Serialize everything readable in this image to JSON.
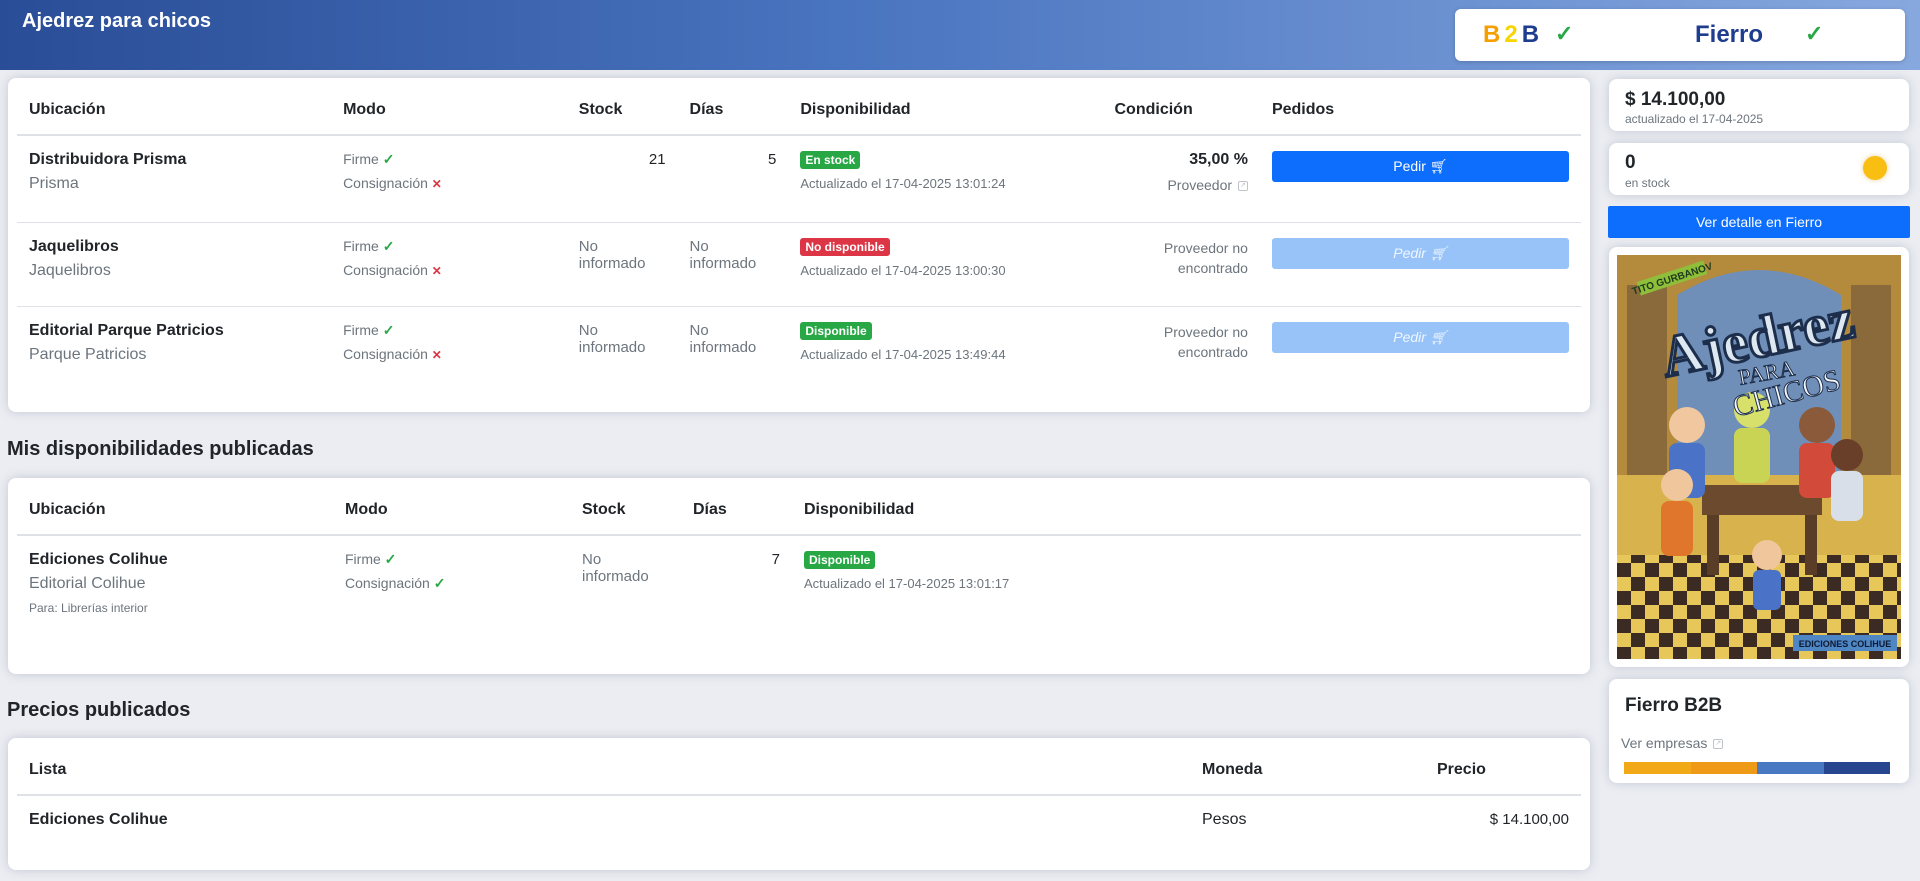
{
  "header": {
    "title": "Ajedrez para chicos"
  },
  "brands": {
    "b2b": [
      "B",
      "2",
      "B"
    ],
    "b2b_check": "✓",
    "fierro": "Fierro",
    "fierro_check": "✓"
  },
  "availability_table": {
    "headers": {
      "ubicacion": "Ubicación",
      "modo": "Modo",
      "stock": "Stock",
      "dias": "Días",
      "disponibilidad": "Disponibilidad",
      "condicion": "Condición",
      "pedidos": "Pedidos"
    },
    "rows": [
      {
        "name": "Distribuidora Prisma",
        "sub": "Prisma",
        "firme": "Firme",
        "consignacion": "Consignación",
        "stock": "21",
        "dias": "5",
        "badge": "En stock",
        "updated": "Actualizado el 17-04-2025 13:01:24",
        "condition": "35,00 %",
        "condition_sub": "Proveedor",
        "pedir": "Pedir"
      },
      {
        "name": "Jaquelibros",
        "sub": "Jaquelibros",
        "firme": "Firme",
        "consignacion": "Consignación",
        "stock": "No informado",
        "dias": "No informado",
        "badge": "No disponible",
        "updated": "Actualizado el 17-04-2025 13:00:30",
        "condition_line1": "Proveedor no",
        "condition_line2": "encontrado",
        "pedir": "Pedir"
      },
      {
        "name": "Editorial Parque Patricios",
        "sub": "Parque Patricios",
        "firme": "Firme",
        "consignacion": "Consignación",
        "stock": "No informado",
        "dias": "No informado",
        "badge": "Disponible",
        "updated": "Actualizado el 17-04-2025 13:49:44",
        "condition_line1": "Proveedor no",
        "condition_line2": "encontrado",
        "pedir": "Pedir"
      }
    ]
  },
  "published_availability": {
    "title": "Mis disponibilidades publicadas",
    "headers": {
      "ubicacion": "Ubicación",
      "modo": "Modo",
      "stock": "Stock",
      "dias": "Días",
      "disponibilidad": "Disponibilidad"
    },
    "rows": [
      {
        "name": "Ediciones Colihue",
        "sub": "Editorial Colihue",
        "note": "Para: Librerías interior",
        "firme": "Firme",
        "consignacion": "Consignación",
        "stock": "No informado",
        "dias": "7",
        "badge": "Disponible",
        "updated": "Actualizado el 17-04-2025 13:01:17"
      }
    ]
  },
  "published_prices": {
    "title": "Precios publicados",
    "headers": {
      "lista": "Lista",
      "moneda": "Moneda",
      "precio": "Precio"
    },
    "rows": [
      {
        "lista": "Ediciones Colihue",
        "moneda": "Pesos",
        "precio": "$ 14.100,00"
      }
    ]
  },
  "sidebar": {
    "price": "$ 14.100,00",
    "price_updated": "actualizado el 17-04-2025",
    "stock": "0",
    "stock_label": "en stock",
    "fierro_button": "Ver detalle en Fierro",
    "cover": {
      "author": "TITO GURBANOV",
      "title_main": "Ajedrez",
      "title_sub1": "PARA",
      "title_sub2": "CHICOS",
      "publisher": "EDICIONES COLIHUE"
    },
    "b2b_title": "Fierro B2B",
    "b2b_link": "Ver empresas",
    "bar_colors": [
      "#f2a918",
      "#ee9a16",
      "#4a79c4",
      "#26478f"
    ]
  }
}
